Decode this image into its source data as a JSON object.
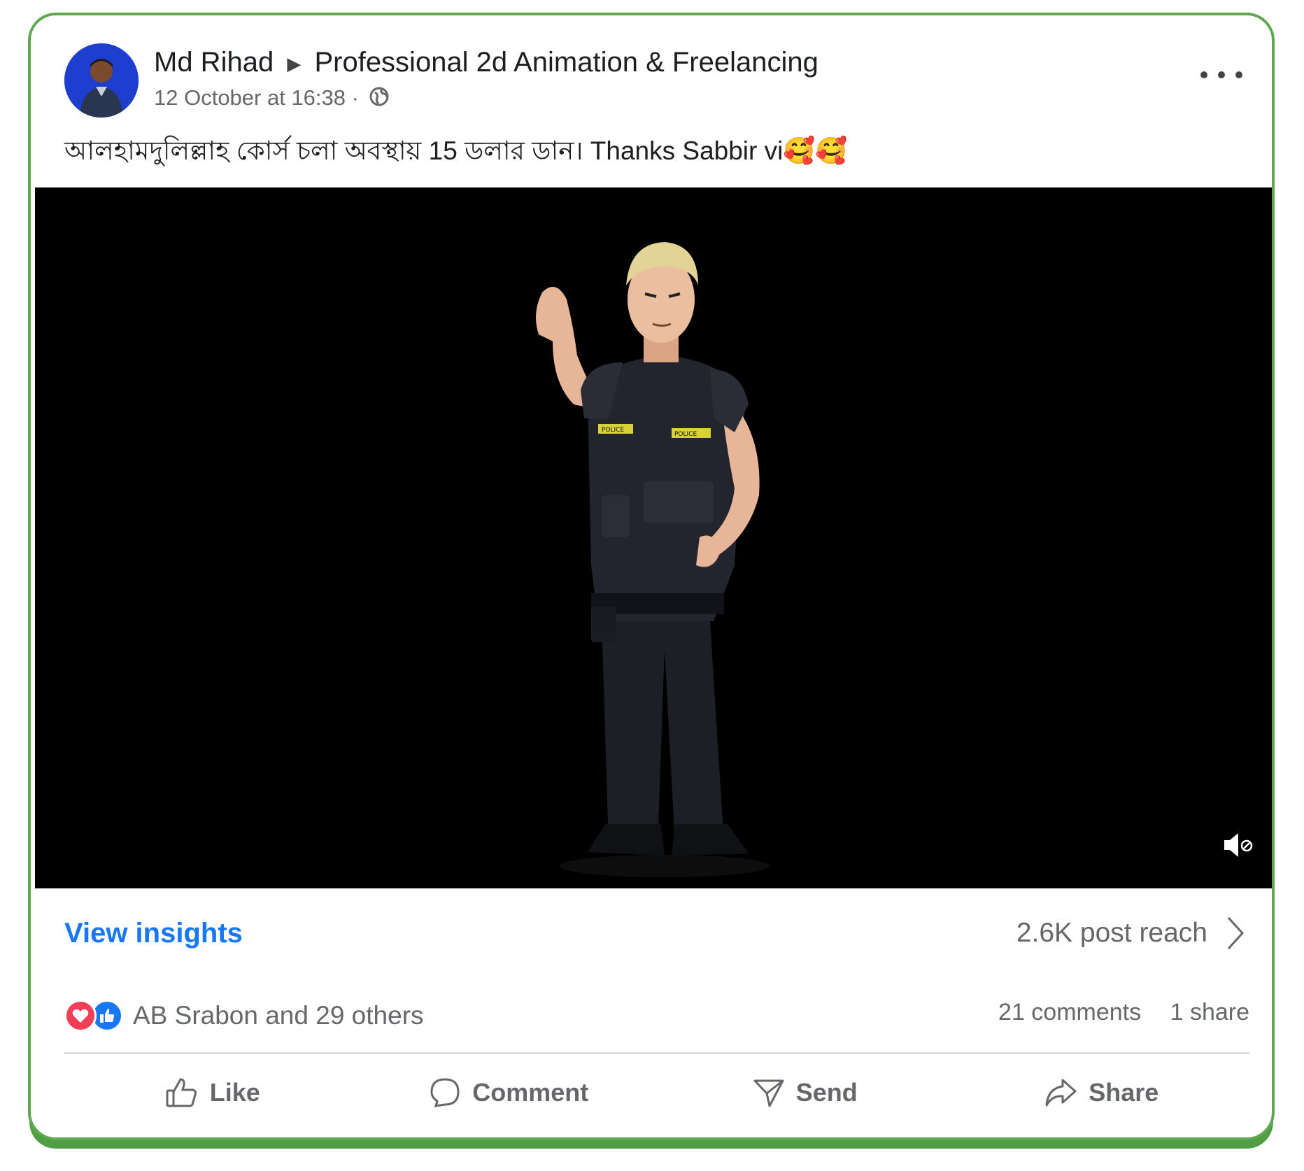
{
  "post": {
    "author": "Md Rihad",
    "group": "Professional 2d Animation & Freelancing",
    "timestamp": "12 October at 16:38 ·",
    "audience_icon": "globe-icon",
    "text": "আলহামদুলিল্লাহ কোর্স চলা  অবস্থায় 15  ডলার ডান। Thanks Sabbir vi",
    "emoji": "🥰🥰"
  },
  "video": {
    "badge_left": "POLICE",
    "badge_right": "POLICE",
    "mute_icon": "muted-speaker-icon"
  },
  "insights": {
    "link_label": "View insights",
    "reach": "2.6K post reach"
  },
  "engagement": {
    "reaction_icons": [
      "love-reaction-icon",
      "like-reaction-icon"
    ],
    "reactors": "AB Srabon and 29 others",
    "comments": "21 comments",
    "shares": "1 share"
  },
  "actions": {
    "like": "Like",
    "comment": "Comment",
    "send": "Send",
    "share": "Share"
  },
  "colors": {
    "border": "#5fa84f",
    "link_blue": "#1877f2",
    "love_red": "#f33e58",
    "muted_text": "#65676b"
  }
}
